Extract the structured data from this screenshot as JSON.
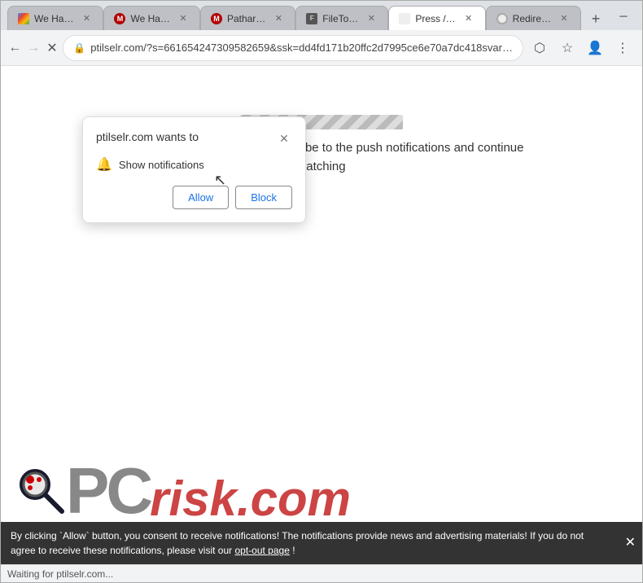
{
  "browser": {
    "tabs": [
      {
        "id": "tab1",
        "title": "We Ha…",
        "active": false,
        "favicon": "google"
      },
      {
        "id": "tab2",
        "title": "We Ha…",
        "active": false,
        "favicon": "malwarebytes"
      },
      {
        "id": "tab3",
        "title": "Pathar…",
        "active": false,
        "favicon": "malwarebytes"
      },
      {
        "id": "tab4",
        "title": "FileTo…",
        "active": false,
        "favicon": "file"
      },
      {
        "id": "tab5",
        "title": "Press /…",
        "active": true,
        "favicon": "empty"
      },
      {
        "id": "tab6",
        "title": "Redire…",
        "active": false,
        "favicon": "redir"
      }
    ],
    "new_tab_label": "+",
    "window_controls": {
      "minimize": "─",
      "maximize": "□",
      "close": "✕"
    },
    "address_bar": {
      "url": "ptilselr.com/?s=661654247309582659&ssk=dd4fd171b20ffc2d7995ce6e70a7dc418svar…",
      "lock_icon": "🔒"
    },
    "nav": {
      "back": "←",
      "forward": "→",
      "reload": "✕",
      "home": ""
    }
  },
  "popup": {
    "title": "ptilselr.com wants to",
    "close_icon": "✕",
    "notification_label": "Show notifications",
    "allow_btn": "Allow",
    "block_btn": "Block"
  },
  "page": {
    "loading_bar_alt": "loading animation",
    "subscribe_text": "Click the «Allow» button to subscribe to the push notifications and continue watching"
  },
  "pcrisk": {
    "pc_text": "PC",
    "risk_text": "risk",
    "com_text": ".com"
  },
  "bottom_bar": {
    "text": "By clicking `Allow` button, you consent to receive notifications! The notifications provide news and advertising materials! If you do not agree to receive these notifications, please visit our ",
    "link_text": "opt-out page",
    "text_end": "!",
    "close_icon": "✕"
  },
  "status_bar": {
    "text": "Waiting for ptilselr.com..."
  }
}
